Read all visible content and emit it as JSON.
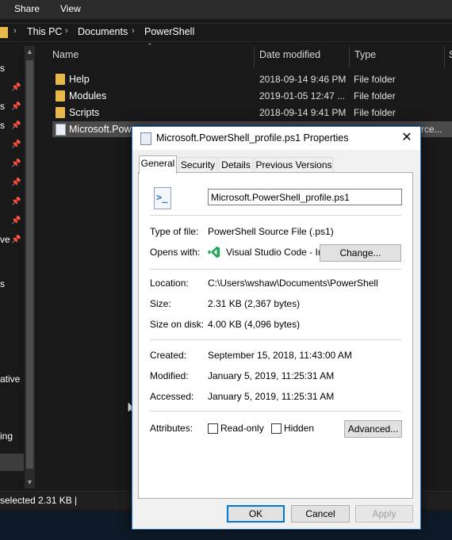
{
  "ribbon": {
    "tabs": [
      "Share",
      "View"
    ]
  },
  "address": {
    "crumbs": [
      "This PC",
      "Documents",
      "PowerShell"
    ]
  },
  "navpane": {
    "fragments": [
      "s",
      "s",
      "s",
      "ve",
      "s",
      "ative",
      "ing"
    ]
  },
  "columns": {
    "name": "Name",
    "date": "Date modified",
    "type": "Type",
    "size": "S"
  },
  "files": [
    {
      "name": "Help",
      "date": "2018-09-14 9:46 PM",
      "type": "File folder"
    },
    {
      "name": "Modules",
      "date": "2019-01-05 12:47 ...",
      "type": "File folder"
    },
    {
      "name": "Scripts",
      "date": "2018-09-14 9:41 PM",
      "type": "File folder"
    },
    {
      "name": "Microsoft.Powe",
      "date": "",
      "type": "rce..."
    }
  ],
  "status": {
    "text": "selected  2.31 KB  |"
  },
  "dialog": {
    "title": "Microsoft.PowerShell_profile.ps1 Properties",
    "close": "✕",
    "tabs": [
      "General",
      "Security",
      "Details",
      "Previous Versions"
    ],
    "filename": "Microsoft.PowerShell_profile.ps1",
    "type_label": "Type of file:",
    "type_value": "PowerShell Source File (.ps1)",
    "opens_label": "Opens with:",
    "opens_value": "Visual Studio Code - Ins",
    "change_button": "Change...",
    "location_label": "Location:",
    "location_value": "C:\\Users\\wshaw\\Documents\\PowerShell",
    "size_label": "Size:",
    "size_value": "2.31 KB (2,367 bytes)",
    "disk_label": "Size on disk:",
    "disk_value": "4.00 KB (4,096 bytes)",
    "created_label": "Created:",
    "created_value": "September 15, 2018, 11:43:00 AM",
    "modified_label": "Modified:",
    "modified_value": "January 5, 2019, 11:25:31 AM",
    "accessed_label": "Accessed:",
    "accessed_value": "January 5, 2019, 11:25:31 AM",
    "attributes_label": "Attributes:",
    "readonly_label": "Read-only",
    "hidden_label": "Hidden",
    "advanced_button": "Advanced...",
    "ok_button": "OK",
    "cancel_button": "Cancel",
    "apply_button": "Apply"
  }
}
